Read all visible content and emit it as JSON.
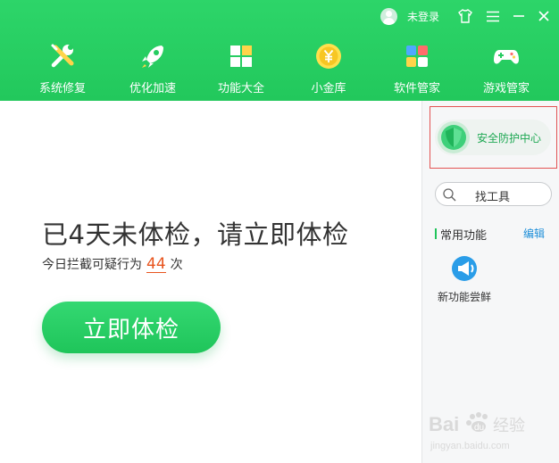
{
  "header": {
    "login_text": "未登录",
    "controls": [
      "shirt-icon",
      "menu-icon",
      "minimize-icon",
      "close-icon"
    ]
  },
  "nav": {
    "items": [
      {
        "label": "系统修复",
        "icon": "wrench-screwdriver-icon"
      },
      {
        "label": "优化加速",
        "icon": "rocket-icon"
      },
      {
        "label": "功能大全",
        "icon": "grid-icon"
      },
      {
        "label": "小金库",
        "icon": "yuan-coin-icon"
      },
      {
        "label": "软件管家",
        "icon": "software-blocks-icon"
      },
      {
        "label": "游戏管家",
        "icon": "gamepad-icon"
      }
    ]
  },
  "main": {
    "headline": "已4天未体检，请立即体检",
    "intercept_prefix": "今日拦截可疑行为",
    "intercept_count": "44",
    "intercept_suffix": "次",
    "check_button": "立即体检"
  },
  "sidebar": {
    "security_center": "安全防护中心",
    "search_label": "找工具",
    "common_title": "常用功能",
    "edit_label": "编辑",
    "new_feature_label": "新功能尝鲜"
  },
  "watermark": {
    "brand": "Bai",
    "brand2": "du",
    "suffix": "经验",
    "url": "jingyan.baidu.com"
  },
  "colors": {
    "accent_green": "#22c85c",
    "count_orange": "#e8541e",
    "link_blue": "#1f8fd9",
    "highlight_red": "#e35353"
  }
}
